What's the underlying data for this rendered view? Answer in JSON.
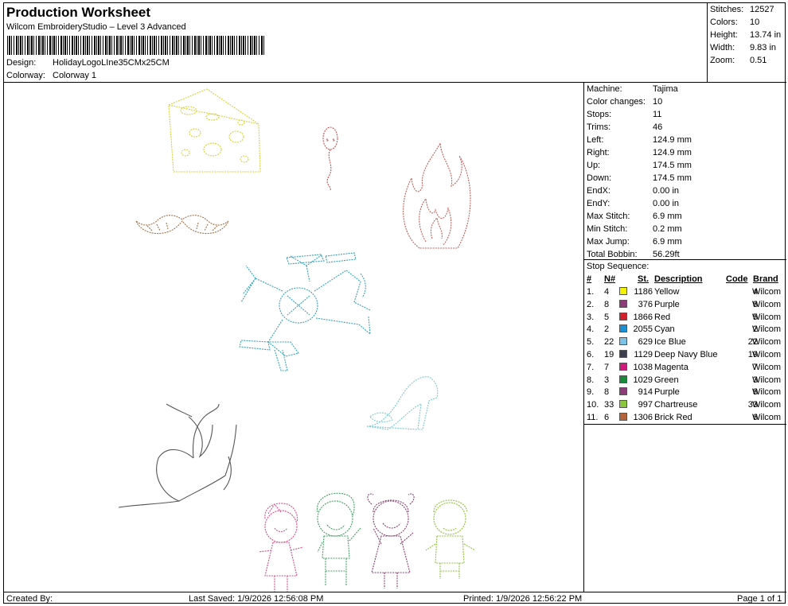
{
  "header": {
    "title": "Production Worksheet",
    "subtitle": "Wilcom EmbroideryStudio – Level 3 Advanced",
    "design_label": "Design:",
    "design_value": "HolidayLogoLIne35CMx25CM",
    "colorway_label": "Colorway:",
    "colorway_value": "Colorway 1"
  },
  "stats": [
    {
      "label": "Stitches:",
      "value": "12527"
    },
    {
      "label": "Colors:",
      "value": "10"
    },
    {
      "label": "Height:",
      "value": "13.74 in"
    },
    {
      "label": "Width:",
      "value": "9.83 in"
    },
    {
      "label": "Zoom:",
      "value": "0.51"
    }
  ],
  "machine_info": [
    {
      "label": "Machine:",
      "value": "Tajima"
    },
    {
      "label": "Color changes:",
      "value": "10"
    },
    {
      "label": "Stops:",
      "value": "11"
    },
    {
      "label": "Trims:",
      "value": "46"
    },
    {
      "label": "Left:",
      "value": "124.9 mm"
    },
    {
      "label": "Right:",
      "value": "124.9 mm"
    },
    {
      "label": "Up:",
      "value": "174.5 mm"
    },
    {
      "label": "Down:",
      "value": "174.5 mm"
    },
    {
      "label": "EndX:",
      "value": "0.00 in"
    },
    {
      "label": "EndY:",
      "value": "0.00 in"
    },
    {
      "label": "Max Stitch:",
      "value": "6.9 mm"
    },
    {
      "label": "Min Stitch:",
      "value": "0.2 mm"
    },
    {
      "label": "Max Jump:",
      "value": "6.9 mm"
    },
    {
      "label": "Total Bobbin:",
      "value": "56.29ft"
    }
  ],
  "stop_sequence": {
    "title": "Stop Sequence:",
    "columns": {
      "num": "#",
      "needle": "N#",
      "stitches": "St.",
      "description": "Description",
      "code": "Code",
      "brand": "Brand"
    },
    "rows": [
      {
        "num": "1.",
        "needle": "4",
        "color": "#f2f200",
        "stitches": "1186",
        "description": "Yellow",
        "code": "4",
        "brand": "Wilcom"
      },
      {
        "num": "2.",
        "needle": "8",
        "color": "#8e3b7a",
        "stitches": "376",
        "description": "Purple",
        "code": "8",
        "brand": "Wilcom"
      },
      {
        "num": "3.",
        "needle": "5",
        "color": "#d2202c",
        "stitches": "1866",
        "description": "Red",
        "code": "5",
        "brand": "Wilcom"
      },
      {
        "num": "4.",
        "needle": "2",
        "color": "#1b8fd2",
        "stitches": "2055",
        "description": "Cyan",
        "code": "2",
        "brand": "Wilcom"
      },
      {
        "num": "5.",
        "needle": "22",
        "color": "#7cc2e6",
        "stitches": "629",
        "description": "Ice Blue",
        "code": "22",
        "brand": "Wilcom"
      },
      {
        "num": "6.",
        "needle": "19",
        "color": "#3c3f4e",
        "stitches": "1129",
        "description": "Deep Navy Blue",
        "code": "19",
        "brand": "Wilcom"
      },
      {
        "num": "7.",
        "needle": "7",
        "color": "#d01a7c",
        "stitches": "1038",
        "description": "Magenta",
        "code": "7",
        "brand": "Wilcom"
      },
      {
        "num": "8.",
        "needle": "3",
        "color": "#1a8a3a",
        "stitches": "1029",
        "description": "Green",
        "code": "3",
        "brand": "Wilcom"
      },
      {
        "num": "9.",
        "needle": "8",
        "color": "#8e3b7a",
        "stitches": "914",
        "description": "Purple",
        "code": "8",
        "brand": "Wilcom"
      },
      {
        "num": "10.",
        "needle": "33",
        "color": "#8cc63f",
        "stitches": "997",
        "description": "Chartreuse",
        "code": "33",
        "brand": "Wilcom"
      },
      {
        "num": "11.",
        "needle": "6",
        "color": "#b5643a",
        "stitches": "1306",
        "description": "Brick Red",
        "code": "6",
        "brand": "Wilcom"
      }
    ]
  },
  "footer": {
    "created": "Created By:",
    "saved": "Last Saved: 1/9/2026 12:56:08 PM",
    "printed": "Printed: 1/9/2026 12:56:22 PM",
    "page": "Page 1 of 1"
  },
  "design_colors": {
    "cheese": "#d9d13a",
    "sperm": "#c05050",
    "fire": "#c0605a",
    "mustache": "#a0704a",
    "drone": "#3aa0b8",
    "shoe": "#80c8d0",
    "woman": "#555555",
    "girl1": "#d0508a",
    "boy1": "#40a060",
    "girl2": "#8a4070",
    "boy2": "#90c040"
  }
}
